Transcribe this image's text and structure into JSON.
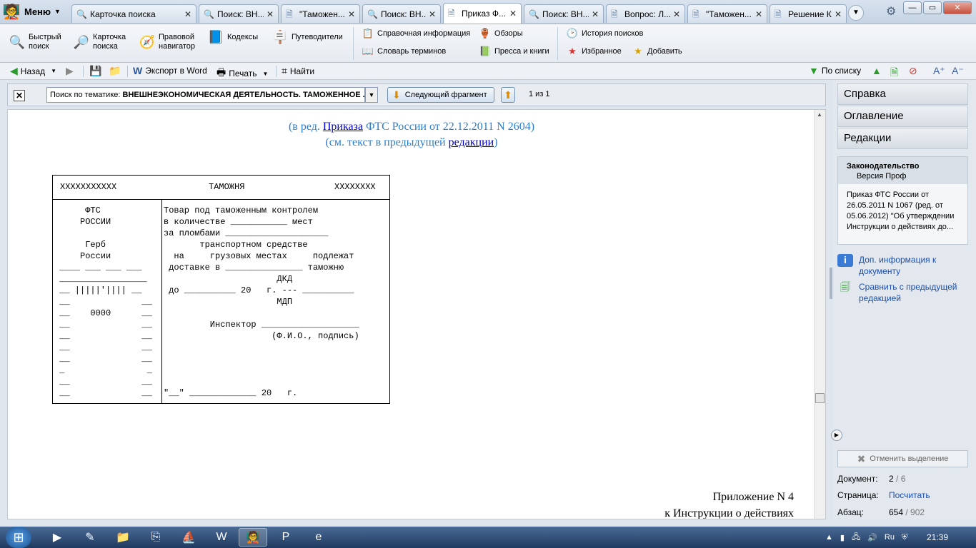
{
  "menu": {
    "label": "Меню"
  },
  "tabs": [
    {
      "label": "Карточка поиска",
      "icon": "search-icon"
    },
    {
      "label": "Поиск: ВН...",
      "icon": "search-icon"
    },
    {
      "label": "\"Таможен...",
      "icon": "document-icon"
    },
    {
      "label": "Поиск: ВН...",
      "icon": "search-icon"
    },
    {
      "label": "Приказ Ф...",
      "icon": "document-icon",
      "active": true
    },
    {
      "label": "Поиск: ВН...",
      "icon": "search-icon"
    },
    {
      "label": "Вопрос: Л...",
      "icon": "document-icon"
    },
    {
      "label": "\"Таможен...",
      "icon": "document-icon"
    },
    {
      "label": "Решение К...",
      "icon": "document-icon"
    }
  ],
  "ribbon": {
    "quick_search": "Быстрый\nпоиск",
    "search_card": "Карточка\nпоиска",
    "legal_navigator": "Правовой\nнавигатор",
    "codes": "Кодексы",
    "guides": "Путеводители",
    "reference_info": "Справочная информация",
    "glossary": "Словарь терминов",
    "reviews": "Обзоры",
    "press_books": "Пресса и книги",
    "search_history": "История поисков",
    "favorites": "Избранное",
    "add": "Добавить"
  },
  "toolbar": {
    "back": "Назад",
    "export_word": "Экспорт в Word",
    "print": "Печать",
    "find": "Найти",
    "by_list": "По списку"
  },
  "searchbar": {
    "prefix": "Поиск по тематике: ",
    "query": "ВНЕШНЕЭКОНОМИЧЕСКАЯ ДЕЯТЕЛЬНОСТЬ. ТАМОЖЕННОЕ ...",
    "next_fragment": "Следующий фрагмент",
    "count": "1 из 1"
  },
  "doc": {
    "line1_pre": "(в ред. ",
    "line1_link": "Приказа",
    "line1_post": " ФТС России от 22.12.2011 N 2604)",
    "line2_pre": "(см. текст в предыдущей ",
    "line2_link": "редакции",
    "line2_post": ")",
    "stamp_header_left": "XXXXXXXXXXX",
    "stamp_header_mid": "ТАМОЖНЯ",
    "stamp_header_right": "XXXXXXXX",
    "stamp_left": "      ФТС\n     РОССИИ\n\n      Герб\n     России\n ____ ___ ___ ___\n _________________\n __ |||||'|||| __\n __              __\n __    0000      __\n __              __\n __              __\n __              __\n __              __\n _                _\n __              __\n __              __",
    "stamp_right": "Товар под таможенным контролем\nв количестве ___________ мест\nза пломбами ____________________\n       транспортном средстве\n  на     грузовых местах     подлежат\n доставке в _______________ таможню\n                      ДКД\n до __________ 20   г. --- __________\n                      МДП\n\n         Инспектор ___________________\n                     (Ф.И.О., подпись)\n\n\n\n\n\"__\" _____________ 20   г.",
    "appendix_title": "Приложение N 4",
    "appendix_sub": "к Инструкции о действиях"
  },
  "rpanel": {
    "help": "Справка",
    "contents": "Оглавление",
    "editions": "Редакции",
    "info_header1": "Законодательство",
    "info_header2": "Версия Проф",
    "info_body": "Приказ ФТС России от 26.05.2011 N 1067 (ред. от 05.06.2012) \"Об утверждении Инструкции о действиях до...",
    "extra_info": "Доп. информация к документу",
    "compare": "Сравнить с предыдущей редакцией",
    "unselect": "Отменить выделение",
    "doc_label": "Документ:",
    "doc_value": "2",
    "doc_total": " / 6",
    "page_label": "Страница:",
    "page_value": "Посчитать",
    "para_label": "Абзац:",
    "para_value": "654",
    "para_total": " / 902"
  },
  "taskbar": {
    "lang": "Ru",
    "clock": "21:39"
  },
  "colors": {
    "doc_blue": "#2a7fd4",
    "link_blue": "#0000cc",
    "panel_link": "#1a4fb0"
  }
}
